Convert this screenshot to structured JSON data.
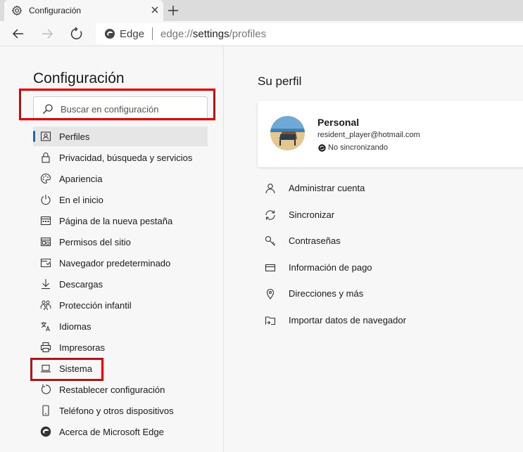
{
  "browser": {
    "tab_title": "Configuración",
    "address_site": "Edge",
    "address_url_prefix": "edge://",
    "address_url_main": "settings",
    "address_url_suffix": "/profiles"
  },
  "sidebar": {
    "title": "Configuración",
    "search_placeholder": "Buscar en configuración",
    "items": [
      {
        "label": "Perfiles",
        "icon": "profile-card-icon",
        "active": true
      },
      {
        "label": "Privacidad, búsqueda y servicios",
        "icon": "lock-icon"
      },
      {
        "label": "Apariencia",
        "icon": "palette-icon"
      },
      {
        "label": "En el inicio",
        "icon": "power-icon"
      },
      {
        "label": "Página de la nueva pestaña",
        "icon": "grid-page-icon"
      },
      {
        "label": "Permisos del sitio",
        "icon": "site-permissions-icon"
      },
      {
        "label": "Navegador predeterminado",
        "icon": "browser-window-icon"
      },
      {
        "label": "Descargas",
        "icon": "download-icon"
      },
      {
        "label": "Protección infantil",
        "icon": "family-icon"
      },
      {
        "label": "Idiomas",
        "icon": "language-icon"
      },
      {
        "label": "Impresoras",
        "icon": "printer-icon"
      },
      {
        "label": "Sistema",
        "icon": "laptop-icon"
      },
      {
        "label": "Restablecer configuración",
        "icon": "reset-icon"
      },
      {
        "label": "Teléfono y otros dispositivos",
        "icon": "phone-icon"
      },
      {
        "label": "Acerca de Microsoft Edge",
        "icon": "edge-logo-icon"
      }
    ]
  },
  "main": {
    "title": "Su perfil",
    "profile": {
      "name": "Personal",
      "email": "resident_player@hotmail.com",
      "sync_status": "No sincronizando"
    },
    "actions": [
      {
        "label": "Administrar cuenta",
        "icon": "person-icon"
      },
      {
        "label": "Sincronizar",
        "icon": "sync-icon"
      },
      {
        "label": "Contraseñas",
        "icon": "key-icon"
      },
      {
        "label": "Información de pago",
        "icon": "credit-card-icon"
      },
      {
        "label": "Direcciones y más",
        "icon": "location-pin-icon"
      },
      {
        "label": "Importar datos de navegador",
        "icon": "import-folder-icon"
      }
    ]
  },
  "colors": {
    "highlight": "#e00000",
    "accent": "#0f6cbd"
  }
}
